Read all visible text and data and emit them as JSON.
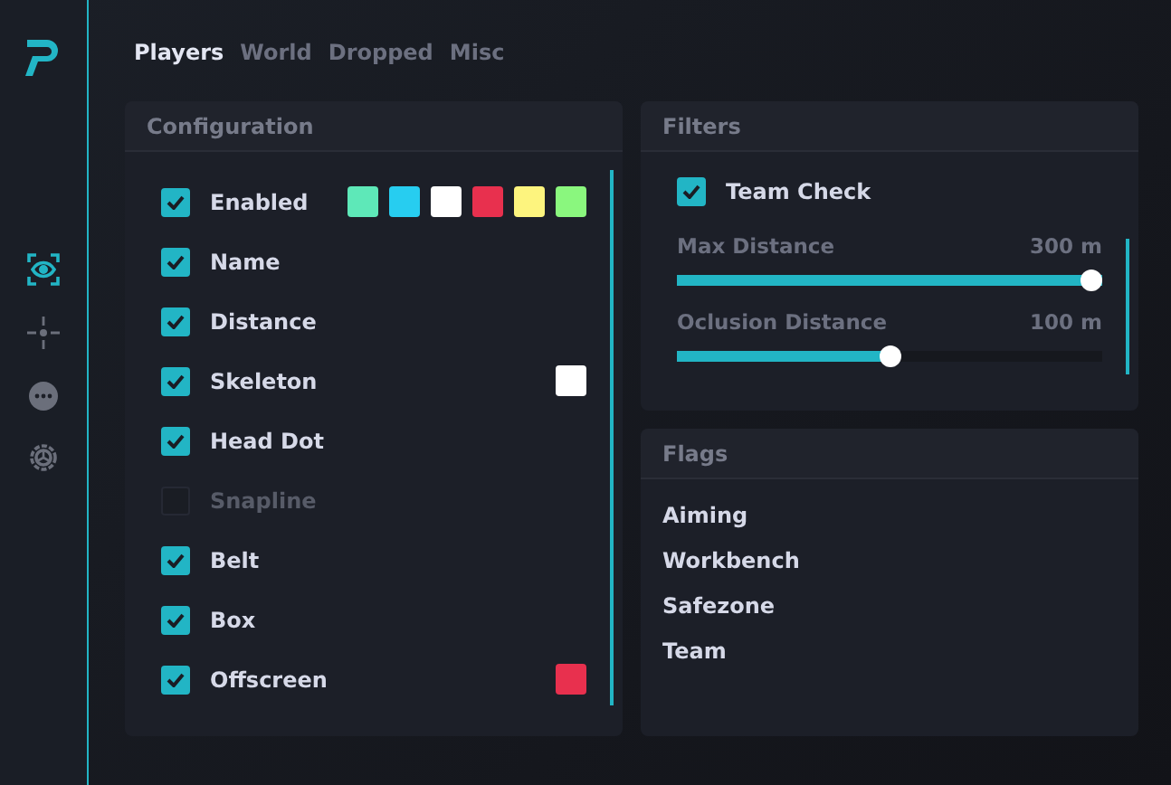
{
  "sidebar": {
    "items": [
      {
        "kind": "eye",
        "selected": true
      },
      {
        "kind": "crosshair",
        "selected": false
      },
      {
        "kind": "more",
        "selected": false
      },
      {
        "kind": "settings",
        "selected": false
      }
    ]
  },
  "tabs": [
    {
      "label": "Players",
      "selected": true
    },
    {
      "label": "World",
      "selected": false
    },
    {
      "label": "Dropped",
      "selected": false
    },
    {
      "label": "Misc",
      "selected": false
    }
  ],
  "configuration": {
    "title": "Configuration",
    "items": [
      {
        "label": "Enabled",
        "checked": true,
        "swatches": [
          {
            "color": "#5ee8b8"
          },
          {
            "color": "#27cdf0"
          },
          {
            "color": "#ffffff"
          },
          {
            "color": "#e8304e"
          },
          {
            "color": "#fdf47e"
          },
          {
            "color": "#8af77e"
          }
        ]
      },
      {
        "label": "Name",
        "checked": true
      },
      {
        "label": "Distance",
        "checked": true
      },
      {
        "label": "Skeleton",
        "checked": true,
        "swatches": [
          {
            "color": "#ffffff"
          }
        ]
      },
      {
        "label": "Head Dot",
        "checked": true
      },
      {
        "label": "Snapline",
        "checked": false
      },
      {
        "label": "Belt",
        "checked": true
      },
      {
        "label": "Box",
        "checked": true
      },
      {
        "label": "Offscreen",
        "checked": true,
        "swatches": [
          {
            "color": "#e8304e"
          }
        ]
      }
    ]
  },
  "filters": {
    "title": "Filters",
    "team_check": {
      "label": "Team Check",
      "checked": true
    },
    "sliders": [
      {
        "label": "Max Distance",
        "reading": "300 m",
        "level": 1.0
      },
      {
        "label": "Oclusion Distance",
        "reading": "100 m",
        "level": 0.5
      }
    ]
  },
  "flags": {
    "title": "Flags",
    "items": [
      "Aiming",
      "Workbench",
      "Safezone",
      "Team"
    ]
  }
}
